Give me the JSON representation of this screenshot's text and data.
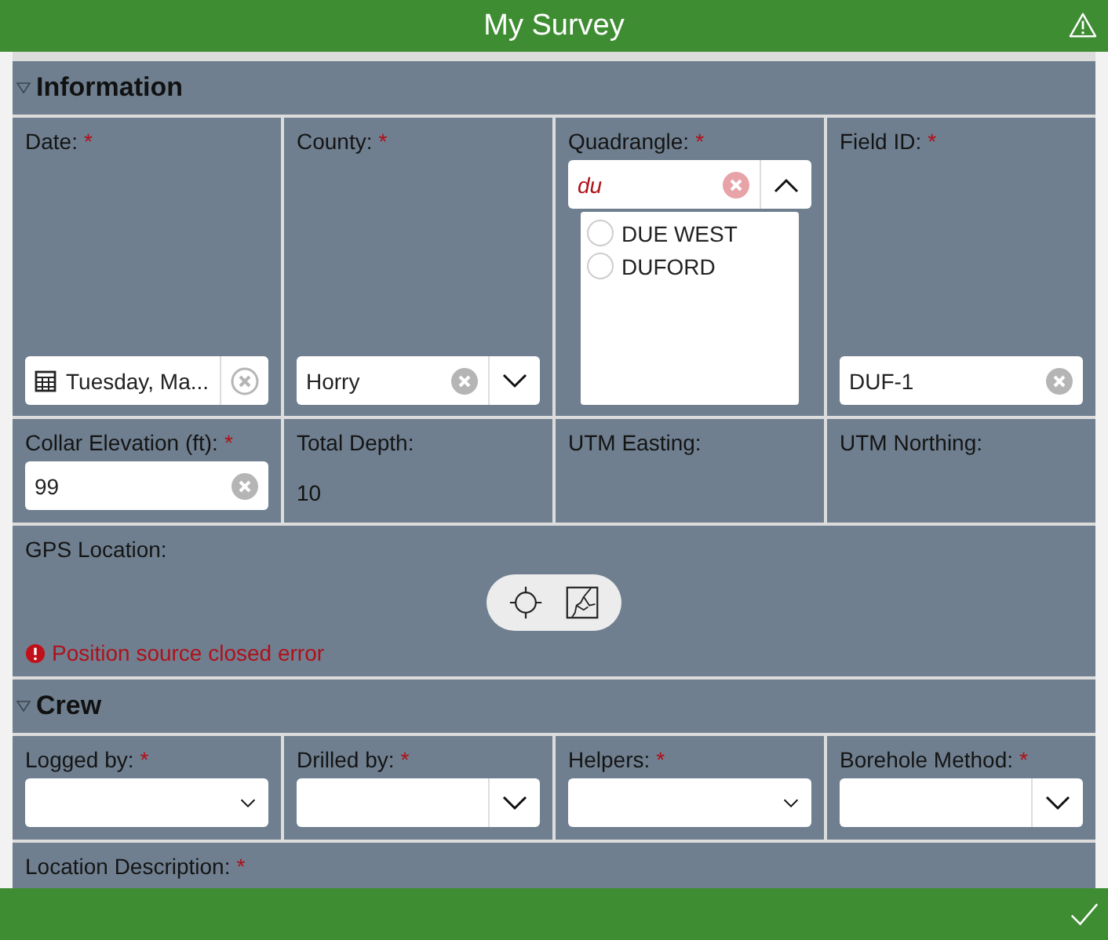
{
  "header": {
    "title": "My Survey"
  },
  "sections": [
    {
      "title": "Information",
      "expanded": true,
      "rows": [
        {
          "cells": [
            {
              "kind": "date",
              "label": "Date:",
              "required_mark": "*",
              "value": "Tuesday, Ma..."
            },
            {
              "kind": "select",
              "label": "County:",
              "required_mark": "*",
              "value": "Horry"
            },
            {
              "kind": "combo",
              "label": "Quadrangle:",
              "required_mark": "*",
              "value": "du",
              "options": [
                {
                  "label": "DUE WEST",
                  "selected": false
                },
                {
                  "label": "DUFORD",
                  "selected": false
                }
              ]
            },
            {
              "kind": "text",
              "label": "Field ID:",
              "required_mark": "*",
              "value": "DUF-1"
            }
          ]
        },
        {
          "cells": [
            {
              "kind": "text",
              "label": "Collar Elevation (ft):",
              "required_mark": "*",
              "value": "99"
            },
            {
              "kind": "readonly",
              "label": "Total Depth:",
              "value": "10"
            },
            {
              "kind": "empty",
              "label": "UTM Easting:"
            },
            {
              "kind": "empty",
              "label": "UTM Northing:"
            }
          ]
        },
        {
          "cells": [
            {
              "kind": "gps",
              "label": "GPS Location:",
              "error": "Position source closed error"
            }
          ]
        }
      ]
    },
    {
      "title": "Crew",
      "expanded": true,
      "rows": [
        {
          "cells": [
            {
              "kind": "dropdown",
              "label": "Logged by:",
              "required_mark": "*",
              "chevron_box": false
            },
            {
              "kind": "dropdown",
              "label": "Drilled by:",
              "required_mark": "*",
              "chevron_box": true
            },
            {
              "kind": "dropdown",
              "label": "Helpers:",
              "required_mark": "*",
              "chevron_box": false
            },
            {
              "kind": "dropdown",
              "label": "Borehole Method:",
              "required_mark": "*",
              "chevron_box": true
            }
          ]
        },
        {
          "cells": [
            {
              "kind": "empty",
              "label": "Location Description:",
              "required_mark": "*"
            }
          ]
        }
      ]
    }
  ]
}
